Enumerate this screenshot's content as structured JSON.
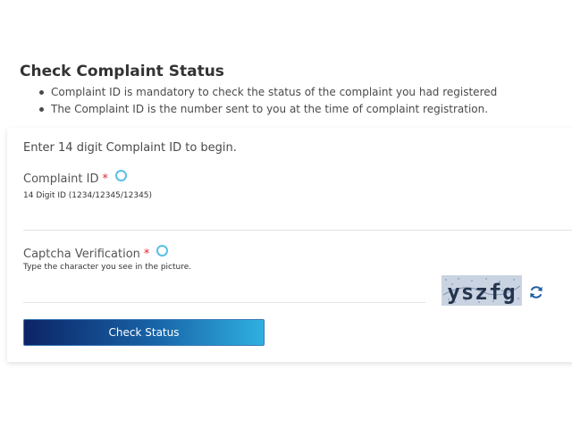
{
  "page": {
    "title": "Check Complaint Status",
    "notes": [
      "Complaint ID is mandatory to check the status of the complaint you had registered",
      "The Complaint ID is the number sent to you at the time of complaint registration."
    ]
  },
  "form": {
    "intro": "Enter 14 digit Complaint ID to begin.",
    "complaint_id": {
      "label": "Complaint ID",
      "required_marker": "*",
      "hint": "14 Digit ID (1234/12345/12345)",
      "value": ""
    },
    "captcha": {
      "label": "Captcha Verification",
      "required_marker": "*",
      "hint": "Type the character you see in the picture.",
      "value": "",
      "image_text": "yszfg"
    },
    "submit_label": "Check Status"
  },
  "colors": {
    "required": "#e0262f",
    "info_icon": "#5bc0e6",
    "button_gradient_start": "#0c2466",
    "button_gradient_end": "#2fb0e0",
    "refresh_icon": "#1f5fa6"
  },
  "icons": {
    "info": "info-circle-icon",
    "refresh": "refresh-icon"
  }
}
